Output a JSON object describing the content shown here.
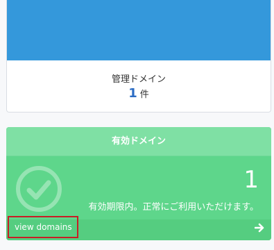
{
  "managed": {
    "label": "管理ドメイン",
    "count": "1",
    "unit": "件"
  },
  "valid": {
    "title": "有効ドメイン",
    "count": "1",
    "status": "有効期限内。正常にご利用いただけます。",
    "link_label": "view domains",
    "icons": {
      "status": "check-circle-icon",
      "link": "arrow-right-icon"
    }
  },
  "colors": {
    "blue_band": "#3498db",
    "green_card": "#5ed68b",
    "green_header": "#7fe0a4",
    "count_blue": "#2b6cc4",
    "highlight_border": "#c81d25"
  }
}
